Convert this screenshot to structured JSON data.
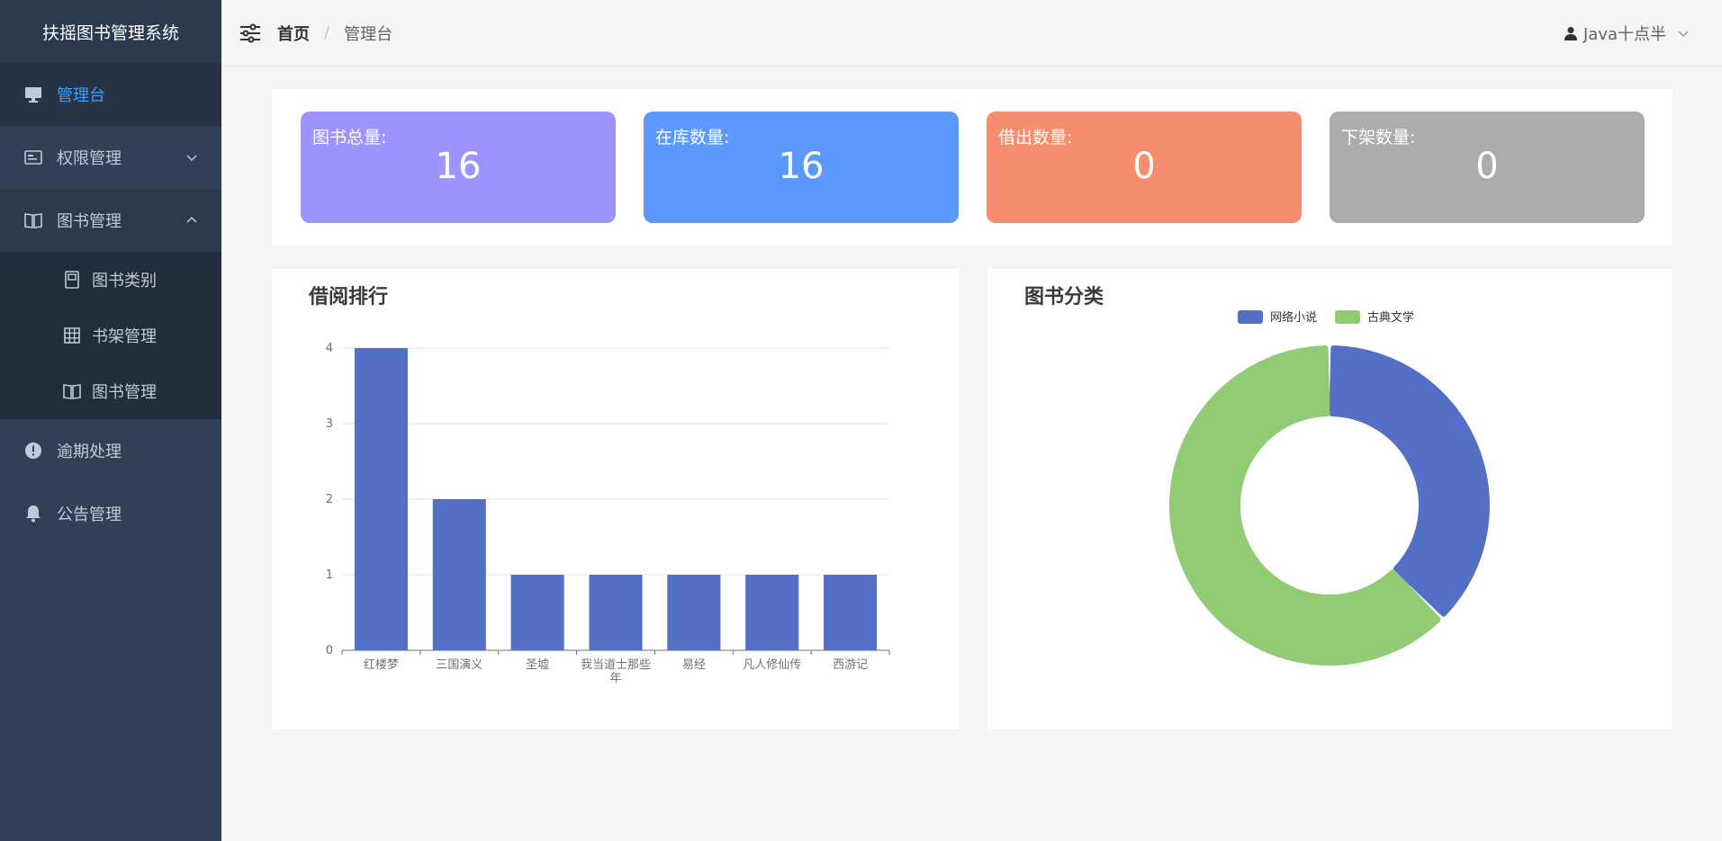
{
  "app": {
    "title": "扶摇图书管理系统"
  },
  "sidebar": {
    "items": [
      {
        "label": "管理台",
        "icon": "monitor-icon",
        "active": true
      },
      {
        "label": "权限管理",
        "icon": "id-card-icon",
        "expanded": false
      },
      {
        "label": "图书管理",
        "icon": "open-book-icon",
        "expanded": true,
        "children": [
          {
            "label": "图书类别",
            "icon": "book-icon"
          },
          {
            "label": "书架管理",
            "icon": "grid-icon"
          },
          {
            "label": "图书管理",
            "icon": "open-book-icon"
          }
        ]
      },
      {
        "label": "逾期处理",
        "icon": "warning-circle-icon"
      },
      {
        "label": "公告管理",
        "icon": "bell-icon"
      }
    ]
  },
  "header": {
    "breadcrumb": {
      "home": "首页",
      "separator": "/",
      "current": "管理台"
    },
    "user": {
      "name": "Java十点半"
    }
  },
  "stats": [
    {
      "label": "图书总量:",
      "value": "16",
      "color": "#9e94ff"
    },
    {
      "label": "在库数量:",
      "value": "16",
      "color": "#5b99ff"
    },
    {
      "label": "借出数量:",
      "value": "0",
      "color": "#f58d6e"
    },
    {
      "label": "下架数量:",
      "value": "0",
      "color": "#adacab"
    }
  ],
  "panels": {
    "ranking_title": "借阅排行",
    "category_title": "图书分类"
  },
  "chart_data": [
    {
      "type": "bar",
      "title": "借阅排行",
      "categories": [
        "红楼梦",
        "三国演义",
        "圣墟",
        "我当道士那些年",
        "易经",
        "凡人修仙传",
        "西游记"
      ],
      "values": [
        4,
        2,
        1,
        1,
        1,
        1,
        1
      ],
      "ylim": [
        0,
        4
      ],
      "yticks": [
        0,
        1,
        2,
        3,
        4
      ],
      "grid": true,
      "color": "#5470c6"
    },
    {
      "type": "pie",
      "title": "图书分类",
      "donut": true,
      "legend_position": "top",
      "slices": [
        {
          "name": "网络小说",
          "value": 6,
          "color": "#5470c6"
        },
        {
          "name": "古典文学",
          "value": 10,
          "color": "#91cc75"
        }
      ]
    }
  ]
}
